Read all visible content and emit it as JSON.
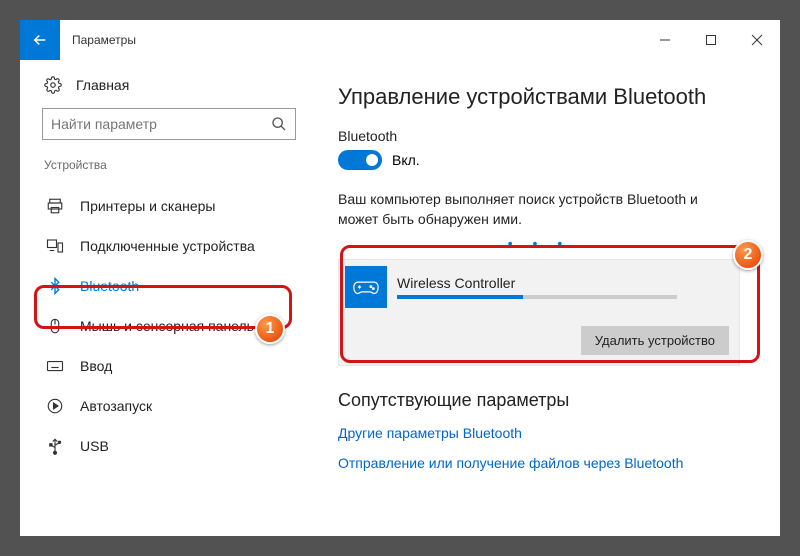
{
  "app_title": "Параметры",
  "home_label": "Главная",
  "search_placeholder": "Найти параметр",
  "section_label": "Устройства",
  "nav": {
    "printers": "Принтеры и сканеры",
    "connected": "Подключенные устройства",
    "bluetooth": "Bluetooth",
    "mouse": "Мышь и сенсорная панель",
    "input": "Ввод",
    "autoplay": "Автозапуск",
    "usb": "USB"
  },
  "page_title": "Управление устройствами Bluetooth",
  "toggle": {
    "label": "Bluetooth",
    "state_text": "Вкл."
  },
  "discover_text": "Ваш компьютер выполняет поиск устройств Bluetooth и может быть обнаружен ими.",
  "device": {
    "name": "Wireless Controller",
    "remove_label": "Удалить устройство"
  },
  "related": {
    "title": "Сопутствующие параметры",
    "link1": "Другие параметры Bluetooth",
    "link2": "Отправление или получение файлов через Bluetooth"
  },
  "badges": {
    "one": "1",
    "two": "2"
  }
}
